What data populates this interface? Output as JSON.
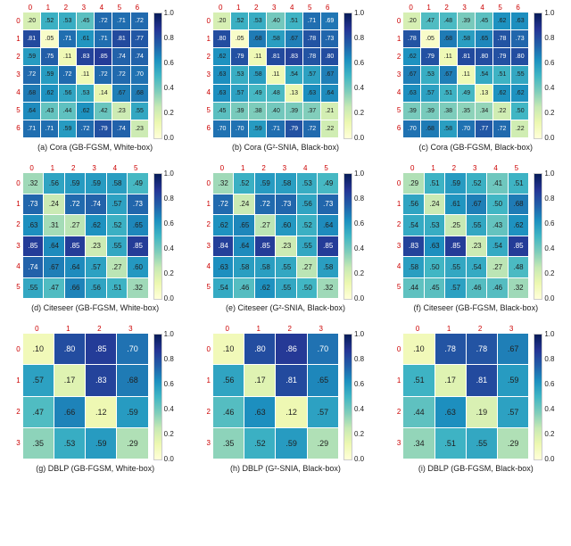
{
  "colorbar_ticks": [
    "0.0",
    "0.2",
    "0.4",
    "0.6",
    "0.8",
    "1.0"
  ],
  "chart_data": [
    {
      "id": "a",
      "type": "heatmap",
      "title": "(a) Cora (GB-FGSM, White-box)",
      "n": 7,
      "vmin": 0.0,
      "vmax": 1.0,
      "x_ticks": [
        "0",
        "1",
        "2",
        "3",
        "4",
        "5",
        "6"
      ],
      "y_ticks": [
        "0",
        "1",
        "2",
        "3",
        "4",
        "5",
        "6"
      ],
      "values": [
        [
          0.2,
          0.52,
          0.53,
          0.45,
          0.72,
          0.71,
          0.72
        ],
        [
          0.81,
          0.05,
          0.71,
          0.61,
          0.71,
          0.81,
          0.77
        ],
        [
          0.59,
          0.75,
          0.11,
          0.83,
          0.85,
          0.74,
          0.74
        ],
        [
          0.72,
          0.59,
          0.72,
          0.11,
          0.72,
          0.72,
          0.7
        ],
        [
          0.68,
          0.62,
          0.56,
          0.53,
          0.14,
          0.67,
          0.68
        ],
        [
          0.64,
          0.43,
          0.44,
          0.62,
          0.42,
          0.23,
          0.55
        ],
        [
          0.71,
          0.71,
          0.59,
          0.72,
          0.79,
          0.74,
          0.23
        ]
      ]
    },
    {
      "id": "b",
      "type": "heatmap",
      "title": "(b) Cora (G²-SNIA, Black-box)",
      "n": 7,
      "vmin": 0.0,
      "vmax": 1.0,
      "x_ticks": [
        "0",
        "1",
        "2",
        "3",
        "4",
        "5",
        "6"
      ],
      "y_ticks": [
        "0",
        "1",
        "2",
        "3",
        "4",
        "5",
        "6"
      ],
      "values": [
        [
          0.2,
          0.52,
          0.53,
          0.4,
          0.51,
          0.71,
          0.69
        ],
        [
          0.8,
          0.05,
          0.68,
          0.58,
          0.67,
          0.78,
          0.73
        ],
        [
          0.62,
          0.79,
          0.11,
          0.81,
          0.83,
          0.78,
          0.8
        ],
        [
          0.63,
          0.53,
          0.58,
          0.11,
          0.54,
          0.57,
          0.67
        ],
        [
          0.63,
          0.57,
          0.49,
          0.48,
          0.13,
          0.63,
          0.64
        ],
        [
          0.45,
          0.39,
          0.38,
          0.4,
          0.39,
          0.37,
          0.21
        ],
        [
          0.7,
          0.7,
          0.59,
          0.71,
          0.79,
          0.72,
          0.22
        ]
      ]
    },
    {
      "id": "c",
      "type": "heatmap",
      "title": "(c) Cora (GB-FGSM, Black-box)",
      "n": 7,
      "vmin": 0.0,
      "vmax": 1.0,
      "x_ticks": [
        "0",
        "1",
        "2",
        "3",
        "4",
        "5",
        "6"
      ],
      "y_ticks": [
        "0",
        "1",
        "2",
        "3",
        "4",
        "5",
        "6"
      ],
      "values": [
        [
          0.2,
          0.47,
          0.48,
          0.39,
          0.45,
          0.62,
          0.63
        ],
        [
          0.78,
          0.05,
          0.68,
          0.58,
          0.65,
          0.78,
          0.73
        ],
        [
          0.62,
          0.79,
          0.11,
          0.81,
          0.8,
          0.79,
          0.8
        ],
        [
          0.67,
          0.53,
          0.67,
          0.11,
          0.54,
          0.51,
          0.55
        ],
        [
          0.63,
          0.57,
          0.51,
          0.49,
          0.13,
          0.62,
          0.62
        ],
        [
          0.39,
          0.39,
          0.38,
          0.35,
          0.34,
          0.22,
          0.5
        ],
        [
          0.7,
          0.68,
          0.58,
          0.7,
          0.77,
          0.72,
          0.22
        ]
      ]
    },
    {
      "id": "d",
      "type": "heatmap",
      "title": "(d) Citeseer (GB-FGSM, White-box)",
      "n": 6,
      "vmin": 0.0,
      "vmax": 1.0,
      "x_ticks": [
        "0",
        "1",
        "2",
        "3",
        "4",
        "5"
      ],
      "y_ticks": [
        "0",
        "1",
        "2",
        "3",
        "4",
        "5"
      ],
      "values": [
        [
          0.32,
          0.56,
          0.59,
          0.59,
          0.58,
          0.49
        ],
        [
          0.73,
          0.24,
          0.72,
          0.74,
          0.57,
          0.73
        ],
        [
          0.63,
          0.31,
          0.27,
          0.62,
          0.52,
          0.65
        ],
        [
          0.85,
          0.64,
          0.85,
          0.23,
          0.55,
          0.85
        ],
        [
          0.74,
          0.67,
          0.64,
          0.57,
          0.27,
          0.6
        ],
        [
          0.55,
          0.47,
          0.66,
          0.56,
          0.51,
          0.32
        ]
      ]
    },
    {
      "id": "e",
      "type": "heatmap",
      "title": "(e) Citeseer (G²-SNIA, Black-box)",
      "n": 6,
      "vmin": 0.0,
      "vmax": 1.0,
      "x_ticks": [
        "0",
        "1",
        "2",
        "3",
        "4",
        "5"
      ],
      "y_ticks": [
        "0",
        "1",
        "2",
        "3",
        "4",
        "5"
      ],
      "values": [
        [
          0.32,
          0.52,
          0.59,
          0.58,
          0.53,
          0.49
        ],
        [
          0.72,
          0.24,
          0.72,
          0.73,
          0.56,
          0.73
        ],
        [
          0.62,
          0.65,
          0.27,
          0.6,
          0.52,
          0.64
        ],
        [
          0.84,
          0.64,
          0.85,
          0.23,
          0.55,
          0.85
        ],
        [
          0.63,
          0.58,
          0.58,
          0.55,
          0.27,
          0.58
        ],
        [
          0.54,
          0.46,
          0.62,
          0.55,
          0.5,
          0.32
        ]
      ]
    },
    {
      "id": "f",
      "type": "heatmap",
      "title": "(f) Citeseer (GB-FGSM, Black-box)",
      "n": 6,
      "vmin": 0.0,
      "vmax": 1.0,
      "x_ticks": [
        "0",
        "1",
        "2",
        "3",
        "4",
        "5"
      ],
      "y_ticks": [
        "0",
        "1",
        "2",
        "3",
        "4",
        "5"
      ],
      "values": [
        [
          0.29,
          0.51,
          0.59,
          0.52,
          0.41,
          0.51
        ],
        [
          0.56,
          0.24,
          0.61,
          0.67,
          0.5,
          0.68
        ],
        [
          0.54,
          0.53,
          0.25,
          0.55,
          0.43,
          0.62
        ],
        [
          0.83,
          0.63,
          0.85,
          0.23,
          0.54,
          0.85
        ],
        [
          0.58,
          0.5,
          0.55,
          0.54,
          0.27,
          0.48
        ],
        [
          0.44,
          0.45,
          0.57,
          0.46,
          0.46,
          0.32
        ]
      ]
    },
    {
      "id": "g",
      "type": "heatmap",
      "title": "(g) DBLP (GB-FGSM, White-box)",
      "n": 4,
      "vmin": 0.0,
      "vmax": 1.0,
      "x_ticks": [
        "0",
        "1",
        "2",
        "3"
      ],
      "y_ticks": [
        "0",
        "1",
        "2",
        "3"
      ],
      "values": [
        [
          0.1,
          0.8,
          0.85,
          0.7
        ],
        [
          0.57,
          0.17,
          0.83,
          0.68
        ],
        [
          0.47,
          0.66,
          0.12,
          0.59
        ],
        [
          0.35,
          0.53,
          0.59,
          0.29
        ]
      ]
    },
    {
      "id": "h",
      "type": "heatmap",
      "title": "(h) DBLP (G²-SNIA, Black-box)",
      "n": 4,
      "vmin": 0.0,
      "vmax": 1.0,
      "x_ticks": [
        "0",
        "1",
        "2",
        "3"
      ],
      "y_ticks": [
        "0",
        "1",
        "2",
        "3"
      ],
      "values": [
        [
          0.1,
          0.8,
          0.86,
          0.7
        ],
        [
          0.56,
          0.17,
          0.81,
          0.65
        ],
        [
          0.46,
          0.63,
          0.12,
          0.57
        ],
        [
          0.35,
          0.52,
          0.59,
          0.29
        ]
      ]
    },
    {
      "id": "i",
      "type": "heatmap",
      "title": "(i) DBLP (GB-FGSM, Black-box)",
      "n": 4,
      "vmin": 0.0,
      "vmax": 1.0,
      "x_ticks": [
        "0",
        "1",
        "2",
        "3"
      ],
      "y_ticks": [
        "0",
        "1",
        "2",
        "3"
      ],
      "values": [
        [
          0.1,
          0.78,
          0.78,
          0.67
        ],
        [
          0.51,
          0.17,
          0.81,
          0.59
        ],
        [
          0.44,
          0.63,
          0.19,
          0.57
        ],
        [
          0.34,
          0.51,
          0.55,
          0.29
        ]
      ]
    }
  ]
}
